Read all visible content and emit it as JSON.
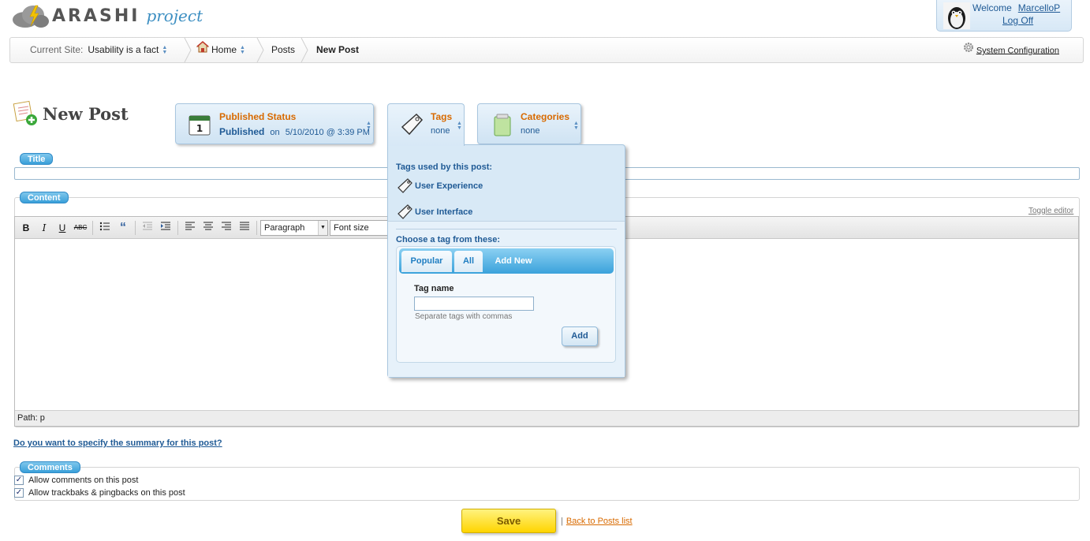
{
  "logo": {
    "name": "ARASHI",
    "sub": "project"
  },
  "user": {
    "welcome": "Welcome",
    "username": "MarcelloP",
    "logoff": "Log Off"
  },
  "breadcrumb": {
    "current_site_label": "Current Site:",
    "current_site_value": "Usability is a fact",
    "home": "Home",
    "posts": "Posts",
    "current": "New Post"
  },
  "system_configuration": "System Configuration",
  "page_title": "New Post",
  "meta": {
    "status": {
      "title": "Published Status",
      "state": "Published",
      "on": "on",
      "date": "5/10/2010 @ 3:39 PM"
    },
    "tags": {
      "title": "Tags",
      "value": "none"
    },
    "categories": {
      "title": "Categories",
      "value": "none"
    }
  },
  "title_section": {
    "legend": "Title",
    "value": ""
  },
  "content_section": {
    "legend": "Content",
    "toggle_editor": "Toggle editor",
    "format_select": "Paragraph",
    "fontsize_select": "Font size",
    "path": "Path: p",
    "toolbar": {
      "bold": "B",
      "italic": "I",
      "underline": "U",
      "strike": "ABC",
      "quote": "“"
    }
  },
  "summary_link": "Do you want to specify the summary for this post?",
  "comments_section": {
    "legend": "Comments",
    "options": [
      {
        "label": "Allow comments on this post",
        "checked": true
      },
      {
        "label": "Allow trackbaks & pingbacks on this post",
        "checked": true
      }
    ]
  },
  "actions": {
    "save": "Save",
    "separator": "|",
    "back": "Back to Posts list"
  },
  "tags_dropdown": {
    "used_heading": "Tags used by this post:",
    "used_tags": [
      "User Experience",
      "User Interface"
    ],
    "choose_heading": "Choose a tag from these:",
    "tabs": [
      "Popular",
      "All",
      "Add New"
    ],
    "active_tab": "Add New",
    "tag_name_label": "Tag name",
    "tag_name_value": "",
    "tag_name_help": "Separate tags with commas",
    "add_button": "Add"
  },
  "colors": {
    "accent_blue": "#3a9fd9",
    "link_blue": "#1f5a95",
    "orange": "#d86a00",
    "save_yellow": "#ffd400"
  }
}
